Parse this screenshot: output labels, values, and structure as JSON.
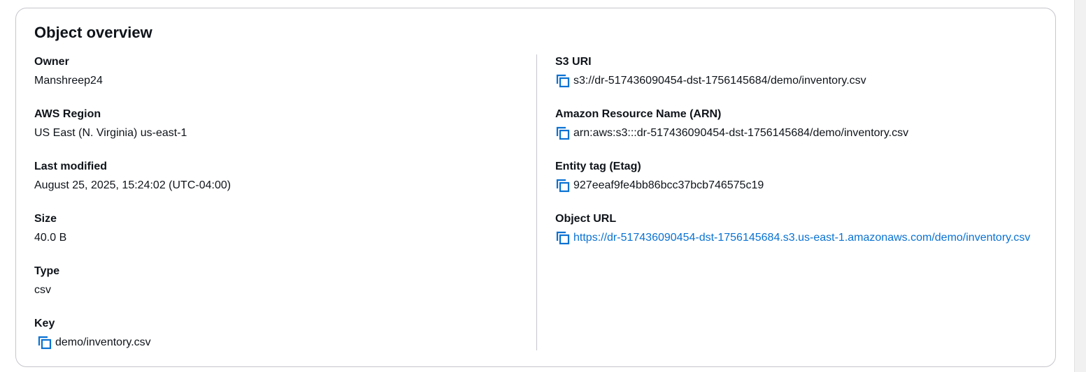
{
  "card": {
    "title": "Object overview"
  },
  "left": {
    "owner": {
      "label": "Owner",
      "value": "Manshreep24"
    },
    "region": {
      "label": "AWS Region",
      "value": "US East (N. Virginia) us-east-1"
    },
    "last_modified": {
      "label": "Last modified",
      "value": "August 25, 2025, 15:24:02 (UTC-04:00)"
    },
    "size": {
      "label": "Size",
      "value": "40.0 B"
    },
    "type": {
      "label": "Type",
      "value": "csv"
    },
    "key": {
      "label": "Key",
      "value": "demo/inventory.csv",
      "icon": "copy-icon"
    }
  },
  "right": {
    "s3_uri": {
      "label": "S3 URI",
      "value": "s3://dr-517436090454-dst-1756145684/demo/inventory.csv",
      "icon": "copy-icon"
    },
    "arn": {
      "label": "Amazon Resource Name (ARN)",
      "value": "arn:aws:s3:::dr-517436090454-dst-1756145684/demo/inventory.csv",
      "icon": "copy-icon"
    },
    "etag": {
      "label": "Entity tag (Etag)",
      "value": "927eeaf9fe4bb86bcc37bcb746575c19",
      "icon": "copy-icon"
    },
    "object_url": {
      "label": "Object URL",
      "value": "https://dr-517436090454-dst-1756145684.s3.us-east-1.amazonaws.com/demo/inventory.csv",
      "icon": "copy-icon"
    }
  },
  "colors": {
    "link": "#0972d3",
    "border": "#c6c6cd",
    "text": "#0f141a"
  }
}
